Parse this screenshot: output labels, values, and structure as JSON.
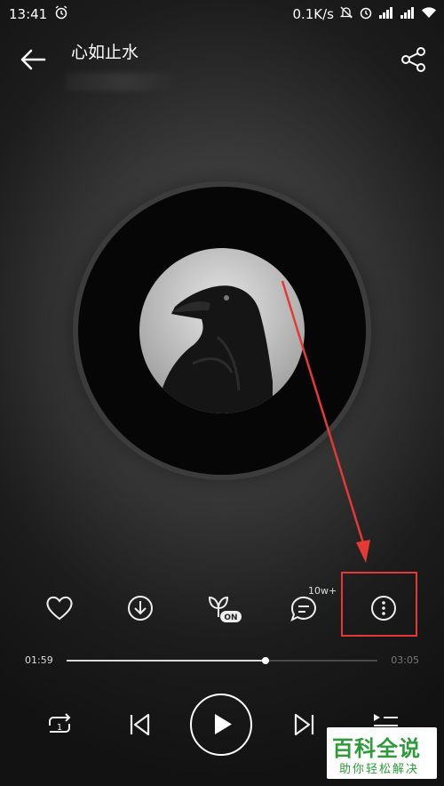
{
  "status": {
    "time": "13:41",
    "net_speed": "0.1K/s"
  },
  "header": {
    "title": "心如止水"
  },
  "actions": {
    "comment_count": "10w+"
  },
  "player": {
    "current_time": "01:59",
    "total_time": "03:05",
    "progress": 0.64
  },
  "watermark": {
    "main": "百科全说",
    "sub": "助你轻松解决"
  },
  "colors": {
    "annotation": "#e53935",
    "watermark": "#2e9b3b"
  },
  "icons": [
    "alarm-icon",
    "mute-icon",
    "signal-icon",
    "wifi-icon",
    "back-arrow-icon",
    "share-icon",
    "heart-icon",
    "download-icon",
    "sound-effect-icon",
    "comment-icon",
    "more-icon",
    "repeat-one-icon",
    "previous-icon",
    "play-icon",
    "next-icon",
    "playlist-icon"
  ]
}
